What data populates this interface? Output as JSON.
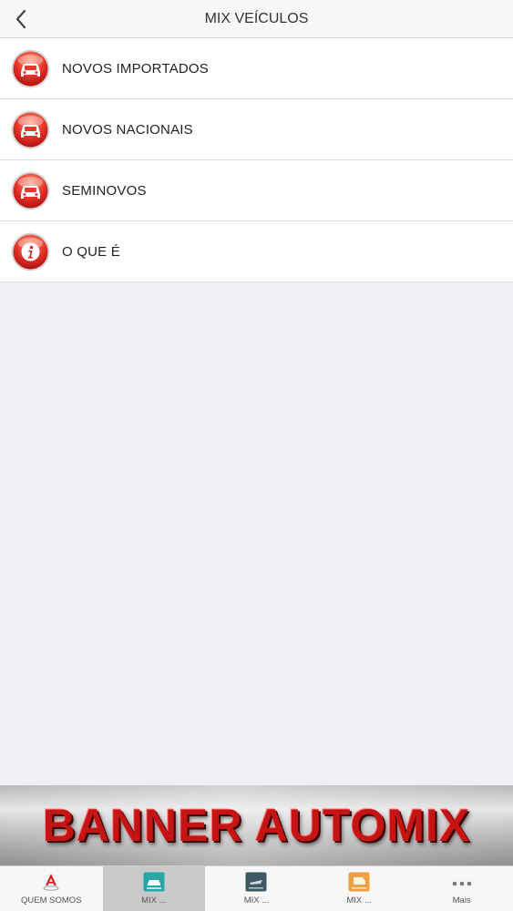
{
  "navbar": {
    "title": "MIX VEÍCULOS",
    "back_icon": "chevron-left-icon"
  },
  "list": [
    {
      "label": "NOVOS IMPORTADOS",
      "icon": "car-icon"
    },
    {
      "label": "NOVOS NACIONAIS",
      "icon": "car-icon"
    },
    {
      "label": "SEMINOVOS",
      "icon": "car-icon"
    },
    {
      "label": "O QUE É",
      "icon": "info-icon"
    }
  ],
  "banner": {
    "text": "BANNER AUTOMIX"
  },
  "tabs": [
    {
      "label": "QUEM SOMOS",
      "icon": "automix-logo-icon",
      "active": false
    },
    {
      "label": "MIX ...",
      "icon": "car-tile-icon",
      "active": true
    },
    {
      "label": "MIX ...",
      "icon": "boat-tile-icon",
      "active": false
    },
    {
      "label": "MIX ...",
      "icon": "vehicle-tile-icon",
      "active": false
    },
    {
      "label": "Mais",
      "icon": "more-dots-icon",
      "active": false
    }
  ],
  "colors": {
    "accent_red": "#d91f1f",
    "tab_teal": "#27a6a6",
    "tab_slate": "#3e5866",
    "tab_orange": "#f0a040"
  }
}
